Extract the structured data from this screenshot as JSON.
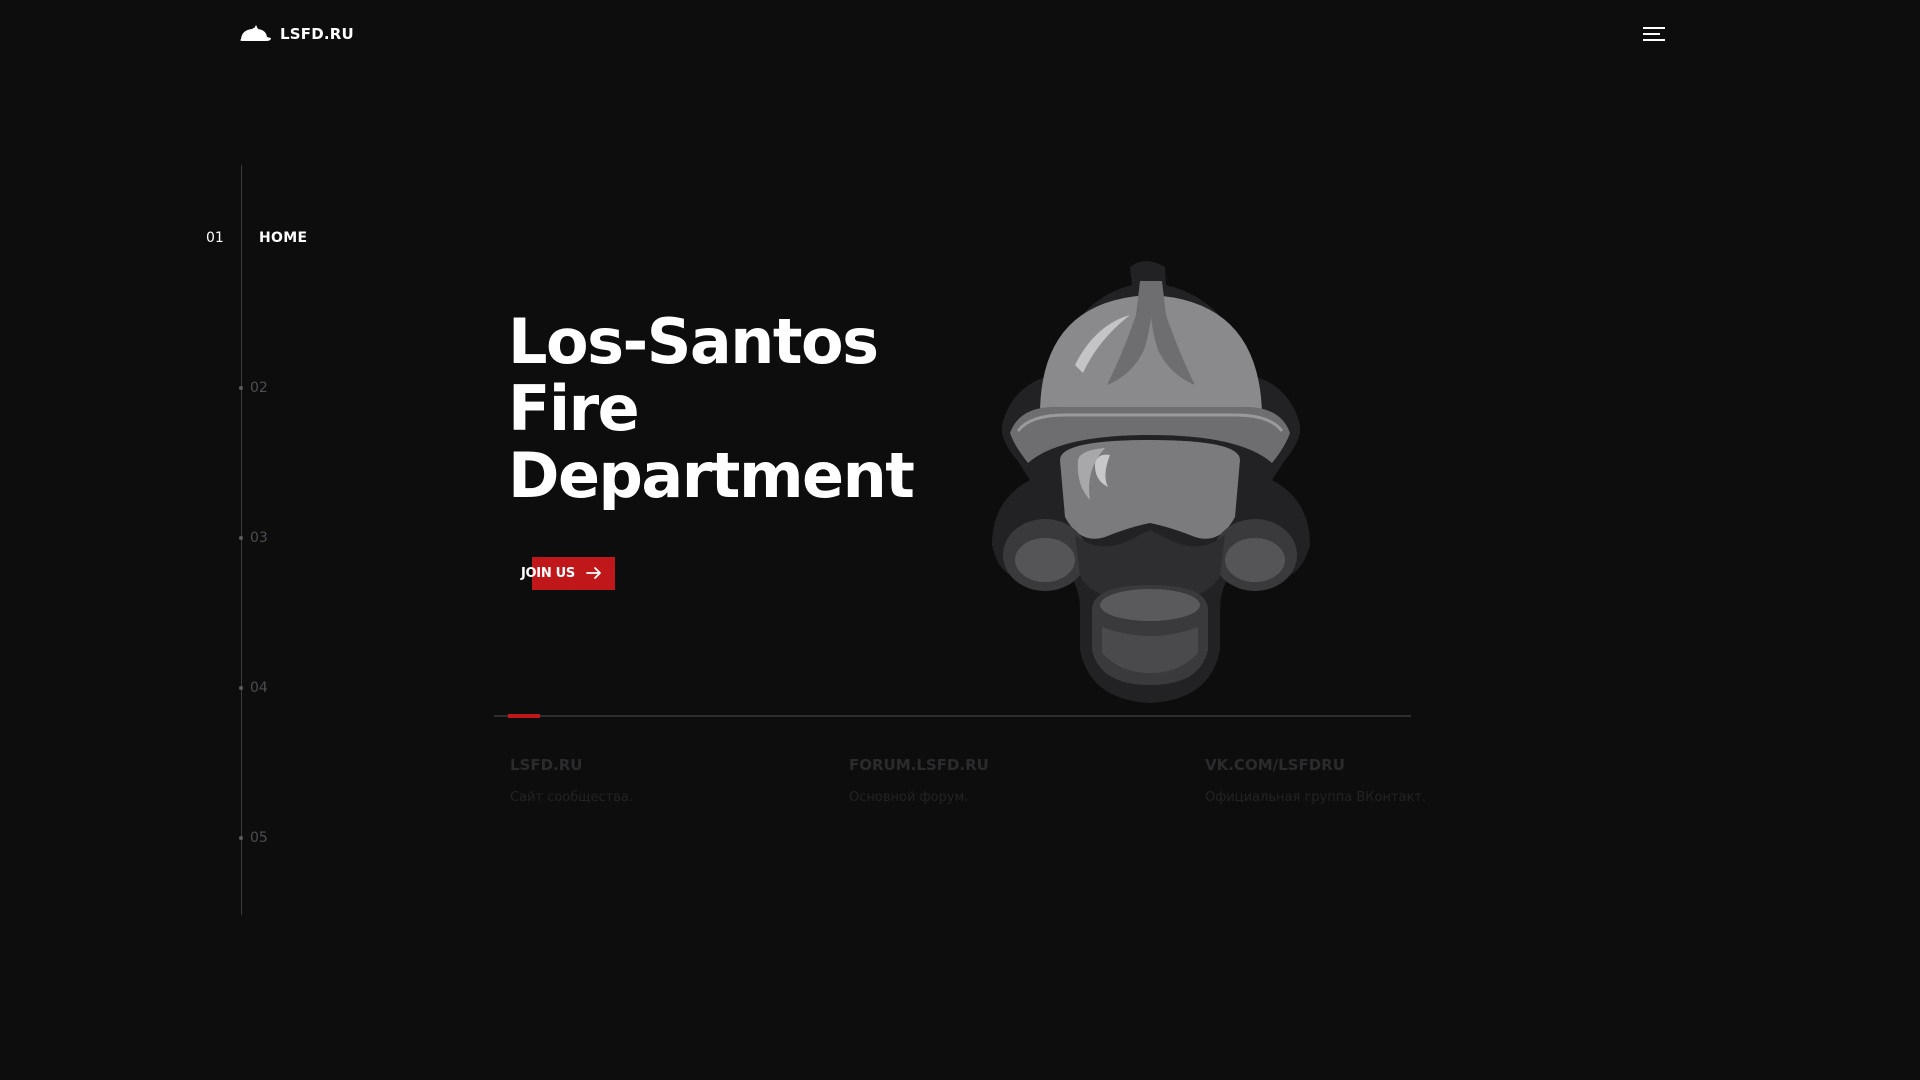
{
  "header": {
    "logo_text": "LSFD.RU",
    "logo_icon": "fire-helmet-icon",
    "menu_icon": "hamburger-menu-icon"
  },
  "side_nav": {
    "items": [
      {
        "number": "01",
        "label": "HOME",
        "active": true
      },
      {
        "number": "02"
      },
      {
        "number": "03"
      },
      {
        "number": "04"
      },
      {
        "number": "05"
      }
    ]
  },
  "hero": {
    "title_lines": [
      "Los-Santos",
      "Fire",
      "Department"
    ],
    "join_label": "JOIN US",
    "join_icon": "arrow-right-icon",
    "illustration": "firefighter-helmet-gas-mask-icon"
  },
  "progress": {
    "fraction": 0.035
  },
  "links": [
    {
      "title": "LSFD.RU",
      "desc": "Сайт сообщества."
    },
    {
      "title": "FORUM.LSFD.RU",
      "desc": "Основной форум."
    },
    {
      "title": "VK.COM/LSFDRU",
      "desc": "Официальная группа ВКонтакт."
    }
  ],
  "colors": {
    "background": "#0d0d0e",
    "accent": "#c0171b",
    "text": "#ffffff",
    "muted": "#4d4d52"
  }
}
